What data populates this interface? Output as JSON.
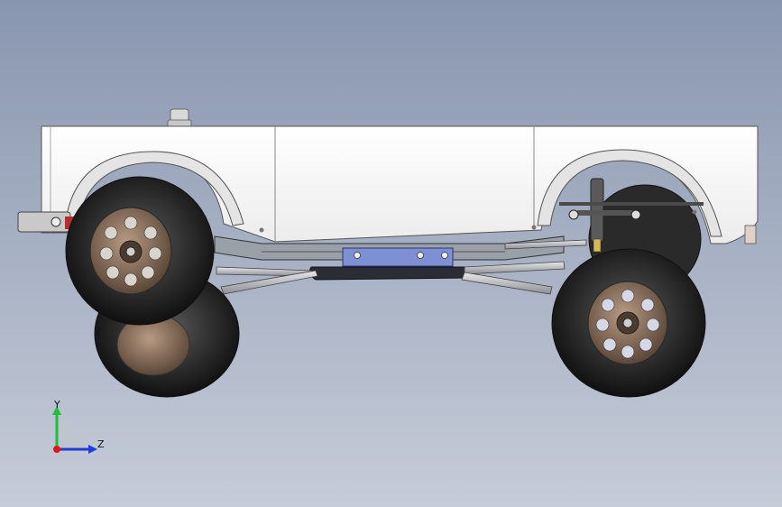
{
  "viewport": {
    "background_top": "#8996b0",
    "background_bottom": "#c6ccd8"
  },
  "model": {
    "body_color": "#f4f4f4",
    "tire_color": "#232323",
    "rim_color": "#6e5a48",
    "frame_color": "#8a8f98",
    "skid_color": "#2a2d36",
    "mount_color": "#7f8fd4"
  },
  "triad": {
    "y_label": "Y",
    "z_label": "Z",
    "y_color": "#1fbf3a",
    "z_color": "#1e3fd6",
    "x_color": "#e01818"
  }
}
